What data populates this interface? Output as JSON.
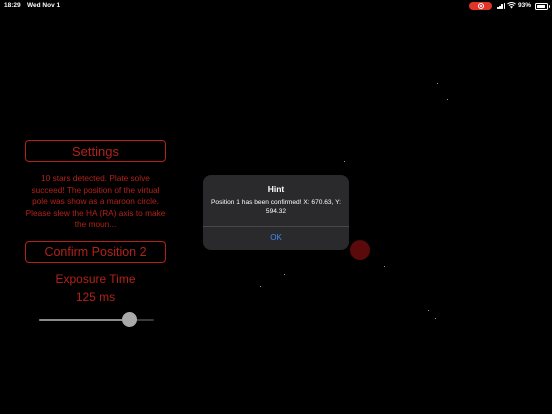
{
  "status_bar": {
    "time": "18:29",
    "date": "Wed Nov 1",
    "battery": "93%",
    "recording_color": "#e0352b"
  },
  "controls": {
    "settings_label": "Settings",
    "info_text": "10 stars detected. Plate solve succeed! The position of the virtual pole was show as a maroon circle. Please slew the HA (RA) axis to make the moun...",
    "confirm_label": "Confirm Position 2",
    "exposure_label": "Exposure Time",
    "exposure_value": "125 ms",
    "exposure_slider_fraction": 0.79,
    "accent_color": "#b3211a"
  },
  "alert": {
    "title": "Hint",
    "message": "Position 1 has been confirmed! X: 670.63, Y: 594.32",
    "ok_label": "OK"
  },
  "icons": [
    "recording-icon",
    "cellular-signal-icon",
    "wifi-icon",
    "battery-icon"
  ]
}
